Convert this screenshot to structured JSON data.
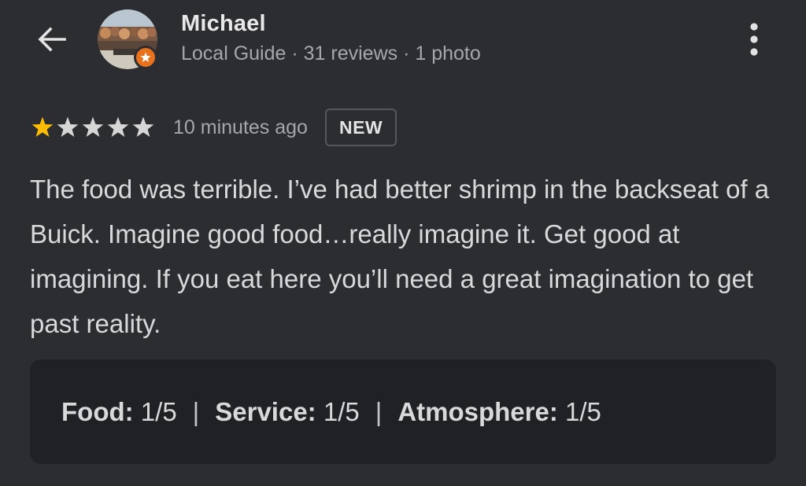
{
  "header": {
    "back_icon": "arrow-back-icon",
    "more_icon": "more-vertical-icon",
    "user": {
      "name": "Michael",
      "meta": "Local Guide · 31 reviews · 1 photo",
      "badge_icon": "local-guide-star-icon",
      "badge_color": "#e8711c"
    }
  },
  "review": {
    "rating": 1,
    "max_rating": 5,
    "star_filled_color": "#fbbc04",
    "star_empty_color": "#d6d6d6",
    "time_ago": "10 minutes ago",
    "badge": "NEW",
    "text": "The food was terrible. I’ve had better shrimp in the backseat of a Buick. Imagine good food…really imagine it. Get good at imagining. If you eat here you’ll need a great imagination to get past reality."
  },
  "sub_ratings": {
    "separator": "|",
    "items": [
      {
        "label": "Food:",
        "value": "1/5"
      },
      {
        "label": "Service:",
        "value": "1/5"
      },
      {
        "label": "Atmosphere:",
        "value": "1/5"
      }
    ]
  },
  "theme": {
    "background": "#2c2d30",
    "card_background": "#202124"
  }
}
